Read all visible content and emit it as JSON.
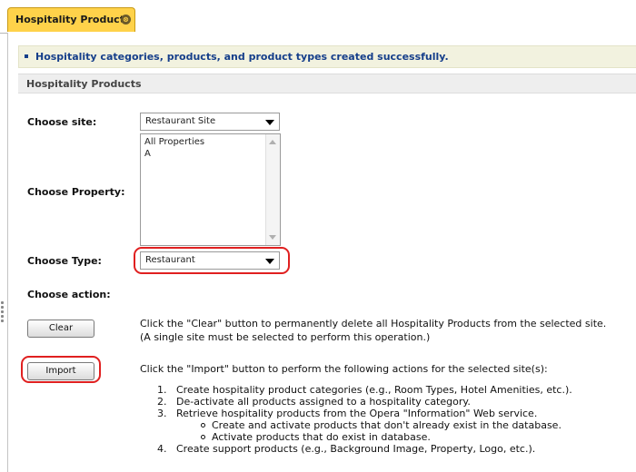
{
  "tab": {
    "label": "Hospitality Products",
    "close_glyph": "⊗"
  },
  "success_message": "Hospitality categories, products, and product types created successfully.",
  "section_title": "Hospitality Products",
  "form": {
    "site_label": "Choose site:",
    "site_value": "Restaurant Site",
    "property_label": "Choose Property:",
    "property_options": [
      "All Properties",
      "A"
    ],
    "type_label": "Choose Type:",
    "type_value": "Restaurant",
    "action_label": "Choose action:"
  },
  "clear": {
    "button_label": "Clear",
    "desc_line1": "Click the \"Clear\" button to permanently delete all Hospitality Products from the selected site.",
    "desc_line2": "(A single site must be selected to perform this operation.)"
  },
  "import": {
    "button_label": "Import",
    "desc": "Click the \"Import\" button to perform the following actions for the selected site(s):",
    "steps": [
      "Create hospitality product categories (e.g., Room Types, Hotel Amenities, etc.).",
      "De-activate all products assigned to a hospitality category.",
      "Retrieve hospitality products from the Opera \"Information\" Web service.",
      "Create support products (e.g., Background Image, Property, Logo, etc.)."
    ],
    "step_numbers": [
      "1.",
      "2.",
      "3.",
      "4."
    ],
    "substeps": [
      "Create and activate products that don't already exist in the database.",
      "Activate products that do exist in database."
    ]
  },
  "colors": {
    "tab_active": "#ffd24a",
    "success_text": "#153e8a",
    "success_bg": "#f2f2df",
    "highlight": "#e02020"
  }
}
